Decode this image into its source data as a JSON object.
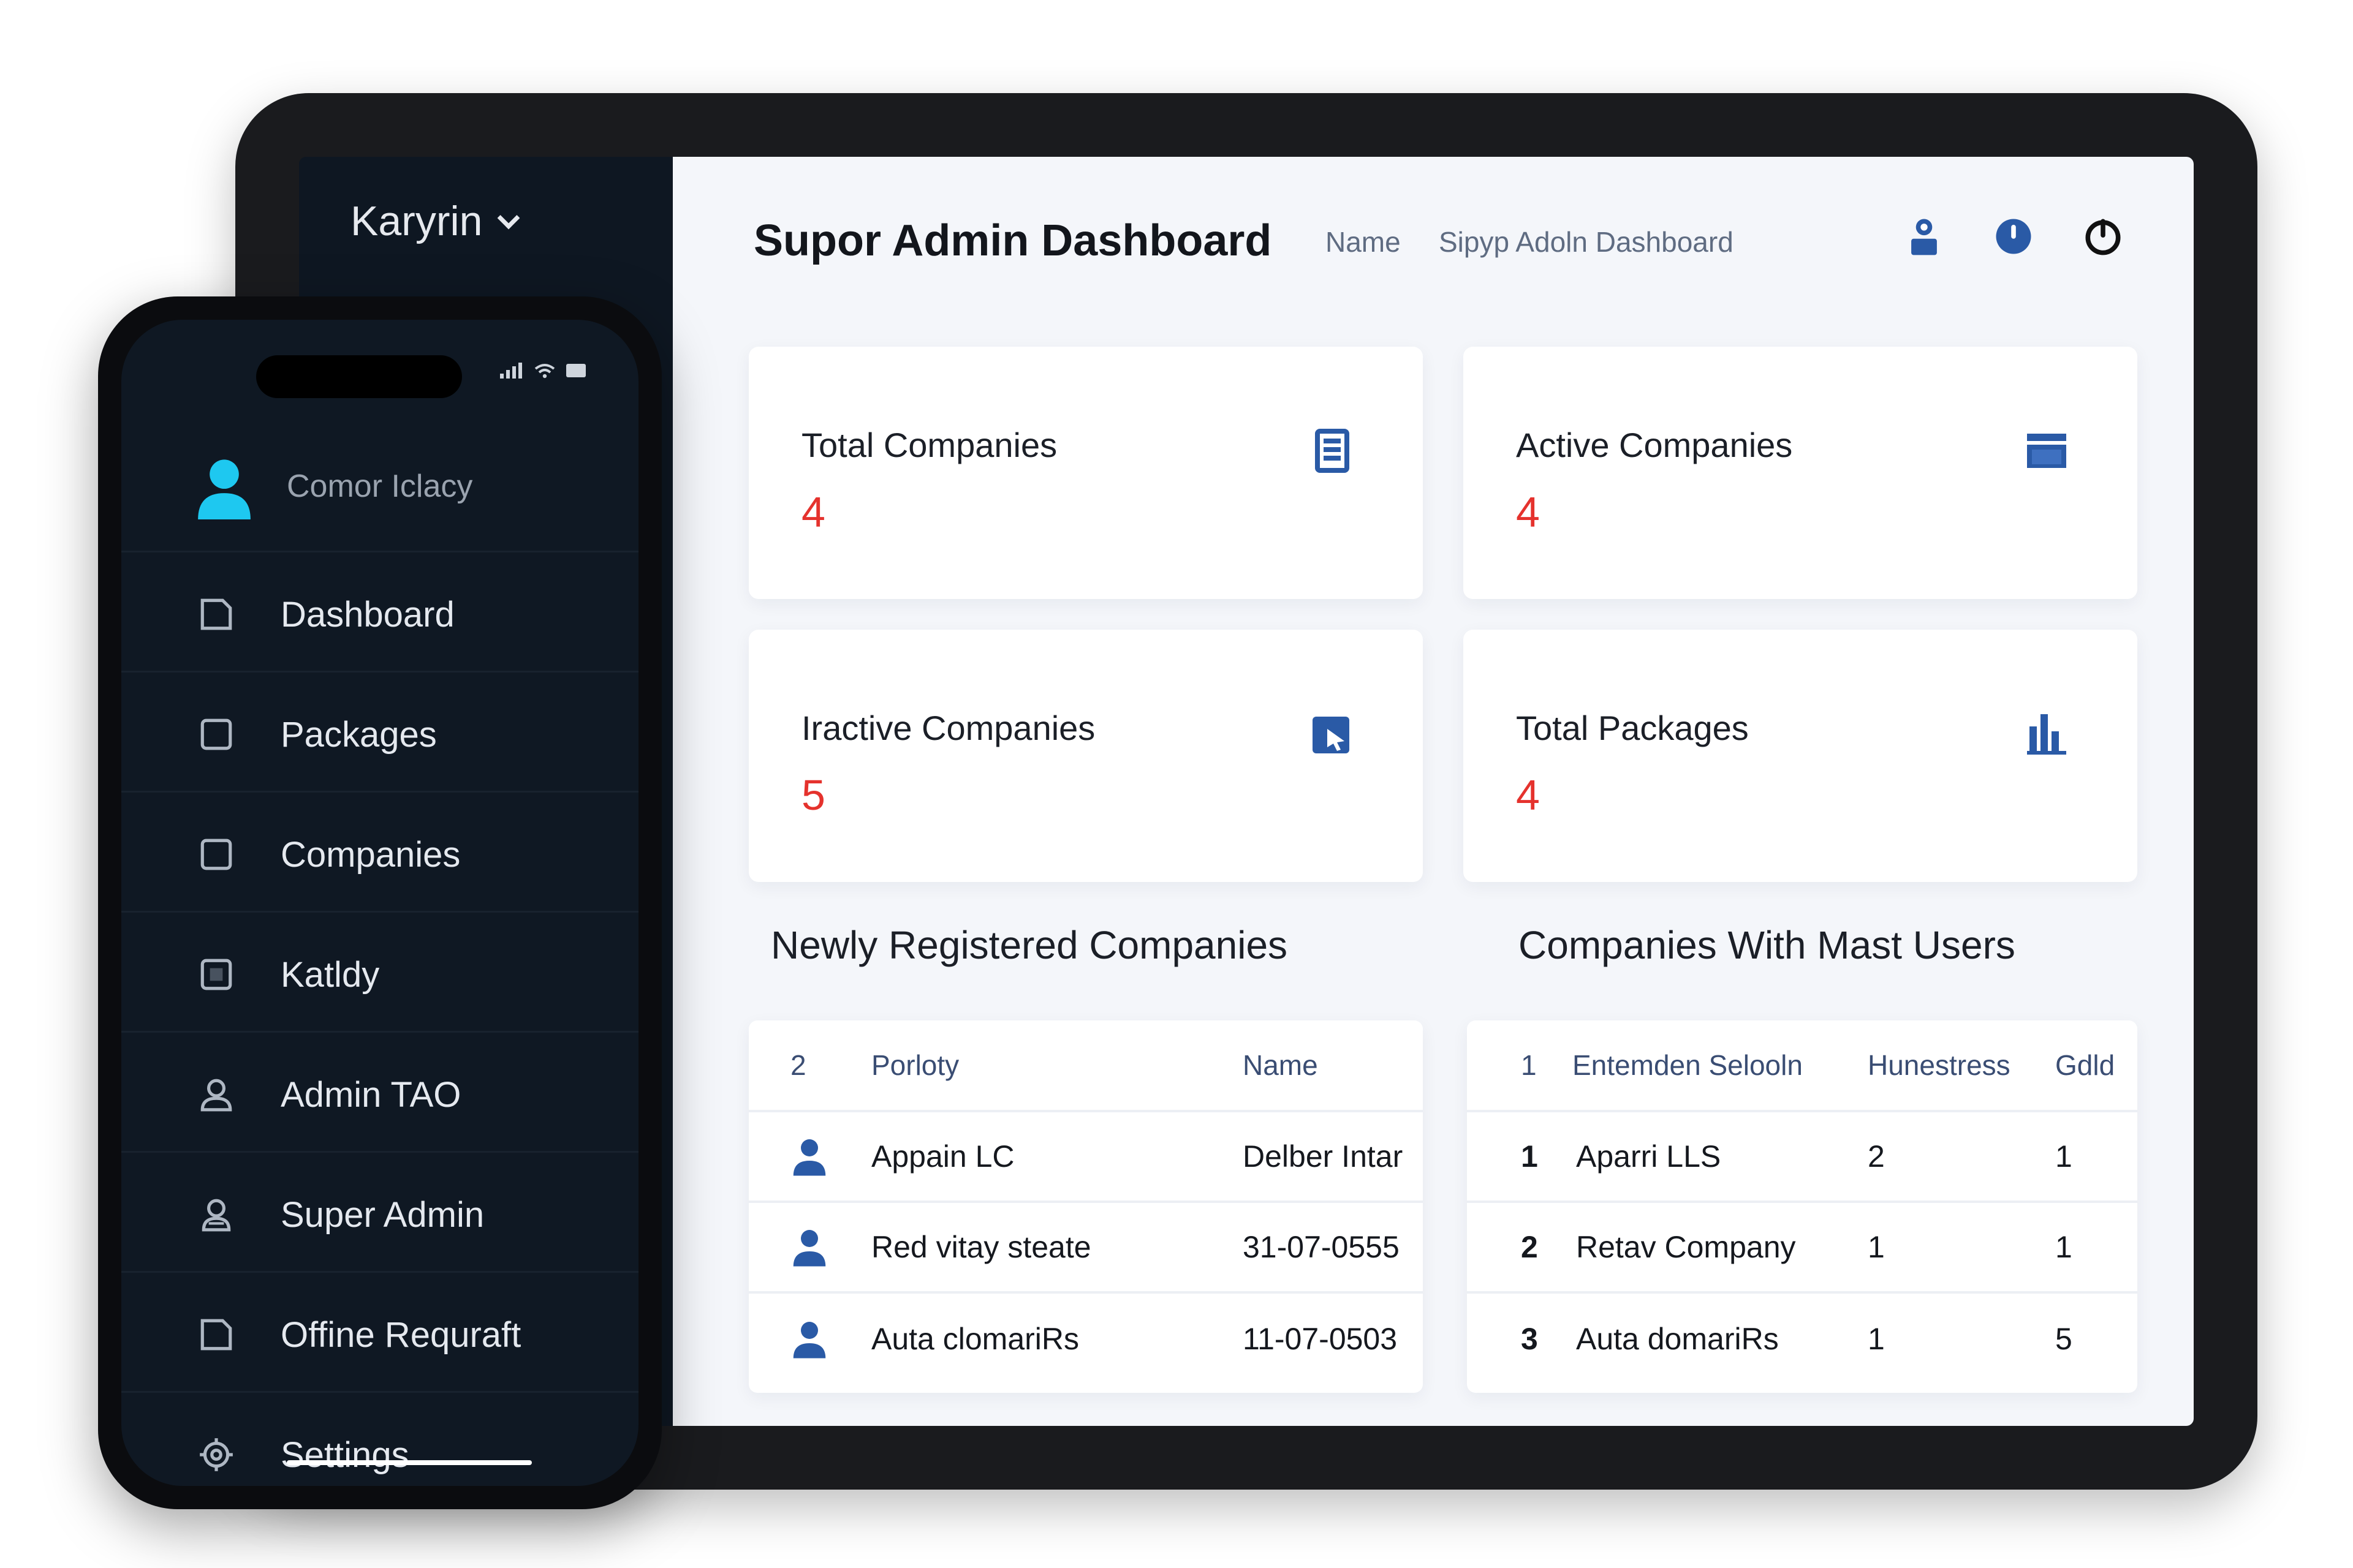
{
  "tablet": {
    "brand": "Karyrin",
    "header": {
      "title": "Supor Admin Dashboard",
      "crumb_1": "Name",
      "crumb_2": "Sipyp Adoln Dashboard"
    },
    "cards": [
      {
        "label": "Total Companies",
        "value": "4",
        "icon": "document-icon"
      },
      {
        "label": "Active Companies",
        "value": "4",
        "icon": "window-icon"
      },
      {
        "label": "Iractive Companies",
        "value": "5",
        "icon": "export-icon"
      },
      {
        "label": "Total Packages",
        "value": "4",
        "icon": "bar-chart-icon"
      }
    ],
    "newly": {
      "title": "Newly Registered Companies",
      "headers": [
        "2",
        "Porloty",
        "Name"
      ],
      "rows": [
        {
          "name": "Appain LC",
          "date": "Delber Intar"
        },
        {
          "name": "Red vitay steate",
          "date": "31-07-0555"
        },
        {
          "name": "Auta clomariRs",
          "date": "11-07-0503"
        }
      ]
    },
    "most": {
      "title": "Companies With Mast Users",
      "headers": [
        "1",
        "Entemden Selooln",
        "Hunestress",
        "Gdld"
      ],
      "rows": [
        {
          "rank": "1",
          "name": "Aparri LLS",
          "c1": "2",
          "c2": "1"
        },
        {
          "rank": "2",
          "name": "Retav Company",
          "c1": "1",
          "c2": "1"
        },
        {
          "rank": "3",
          "name": "Auta domariRs",
          "c1": "1",
          "c2": "5"
        }
      ]
    }
  },
  "phone": {
    "user_name": "Comor Iclacy",
    "nav": [
      {
        "label": "Dashboard",
        "icon": "dashboard-icon"
      },
      {
        "label": "Packages",
        "icon": "package-icon"
      },
      {
        "label": "Companies",
        "icon": "building-icon"
      },
      {
        "label": "Katldy",
        "icon": "category-icon"
      },
      {
        "label": "Admin TAO",
        "icon": "user-icon"
      },
      {
        "label": "Super Admin",
        "icon": "super-admin-icon"
      },
      {
        "label": "Offine Requraft",
        "icon": "request-icon"
      },
      {
        "label": "Settings",
        "icon": "settings-icon"
      }
    ]
  },
  "colors": {
    "accent_blue": "#2a5aa6",
    "value_red": "#e5322d",
    "avatar_cyan": "#1ec8f0",
    "sidebar_dark": "#0e1722"
  }
}
